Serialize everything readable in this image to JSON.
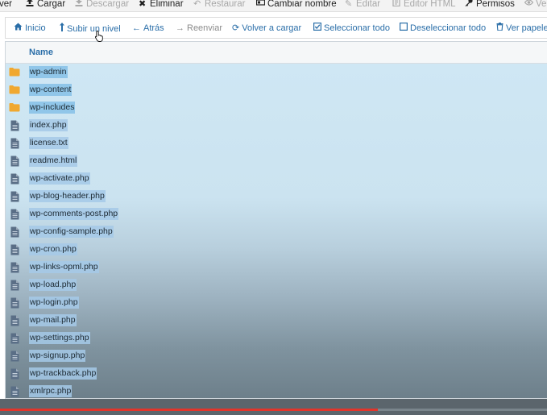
{
  "toolbar": {
    "items": [
      {
        "label": "ver",
        "icon": "",
        "disabled": false
      },
      {
        "label": "Cargar",
        "icon": "upload-icon",
        "disabled": false
      },
      {
        "label": "Descargar",
        "icon": "download-icon",
        "disabled": true
      },
      {
        "label": "Eliminar",
        "icon": "close-icon",
        "disabled": false
      },
      {
        "label": "Restaurar",
        "icon": "undo-icon",
        "disabled": true
      },
      {
        "label": "Cambiar nombre",
        "icon": "rename-icon",
        "disabled": false
      },
      {
        "label": "Editar",
        "icon": "pencil-icon",
        "disabled": true
      },
      {
        "label": "Editor HTML",
        "icon": "html-editor-icon",
        "disabled": true
      },
      {
        "label": "Permisos",
        "icon": "key-icon",
        "disabled": false
      },
      {
        "label": "Ver",
        "icon": "eye-icon",
        "disabled": true
      }
    ]
  },
  "nav": {
    "items": [
      {
        "label": "Inicio",
        "icon": "home-icon",
        "disabled": false
      },
      {
        "label": "Subir un nivel",
        "icon": "level-up-icon",
        "disabled": false
      },
      {
        "label": "Atrás",
        "icon": "arrow-left-icon",
        "disabled": false
      },
      {
        "label": "Reenviar",
        "icon": "arrow-right-icon",
        "disabled": true
      },
      {
        "label": "Volver a cargar",
        "icon": "refresh-icon",
        "disabled": false
      },
      {
        "label": "Seleccionar todo",
        "icon": "checkbox-checked-icon",
        "disabled": false
      },
      {
        "label": "Deseleccionar todo",
        "icon": "checkbox-empty-icon",
        "disabled": false
      },
      {
        "label": "Ver papelera",
        "icon": "trash-icon",
        "disabled": false
      }
    ]
  },
  "list": {
    "header_name": "Name",
    "files": [
      {
        "name": "wp-admin",
        "type": "folder"
      },
      {
        "name": "wp-content",
        "type": "folder"
      },
      {
        "name": "wp-includes",
        "type": "folder"
      },
      {
        "name": "index.php",
        "type": "file"
      },
      {
        "name": "license.txt",
        "type": "file"
      },
      {
        "name": "readme.html",
        "type": "file"
      },
      {
        "name": "wp-activate.php",
        "type": "file"
      },
      {
        "name": "wp-blog-header.php",
        "type": "file"
      },
      {
        "name": "wp-comments-post.php",
        "type": "file"
      },
      {
        "name": "wp-config-sample.php",
        "type": "file"
      },
      {
        "name": "wp-cron.php",
        "type": "file"
      },
      {
        "name": "wp-links-opml.php",
        "type": "file"
      },
      {
        "name": "wp-load.php",
        "type": "file"
      },
      {
        "name": "wp-login.php",
        "type": "file"
      },
      {
        "name": "wp-mail.php",
        "type": "file"
      },
      {
        "name": "wp-settings.php",
        "type": "file"
      },
      {
        "name": "wp-signup.php",
        "type": "file"
      },
      {
        "name": "wp-trackback.php",
        "type": "file"
      },
      {
        "name": "xmlrpc.php",
        "type": "file"
      }
    ]
  },
  "colors": {
    "link": "#2a6ea8",
    "folder": "#f0a830",
    "file": "#5a6e86",
    "progress": "#e3342a"
  },
  "video_progress": 0.69
}
